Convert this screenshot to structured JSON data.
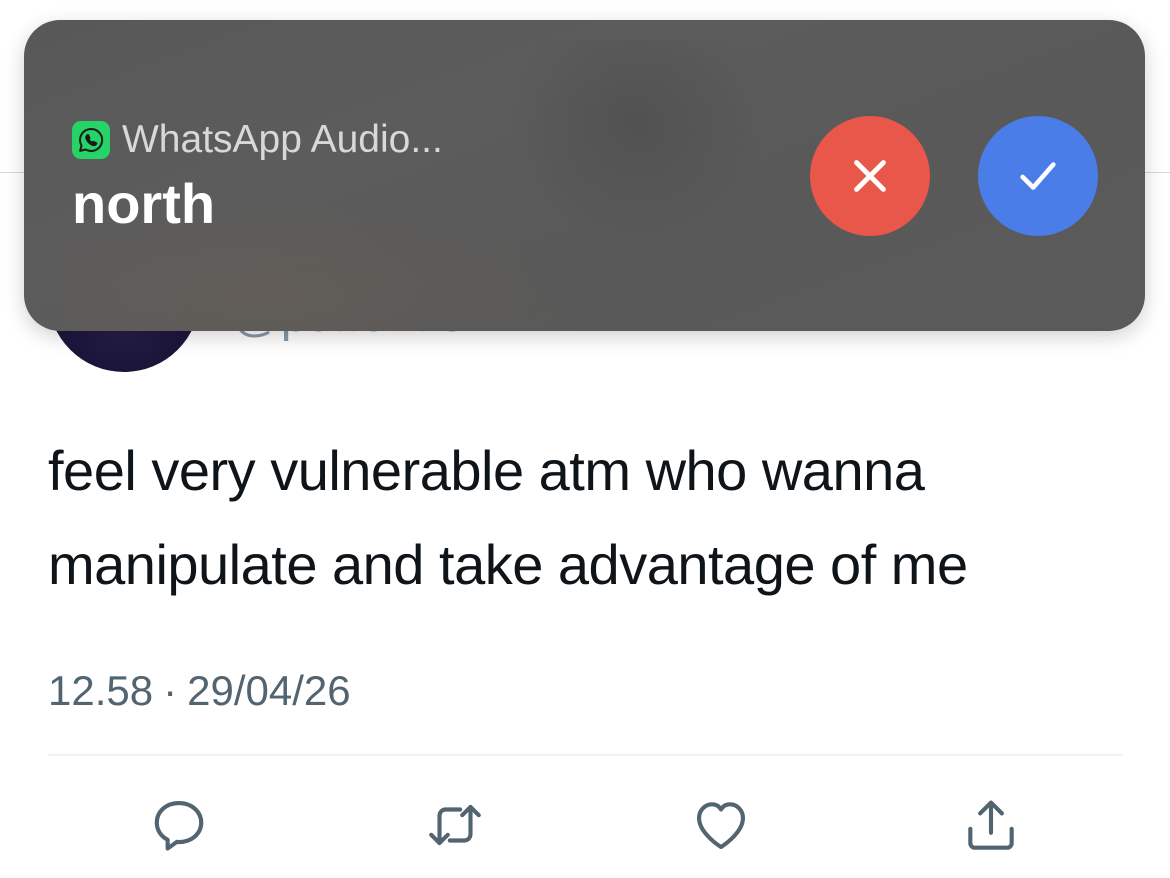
{
  "colors": {
    "decline": "#e8574a",
    "accept": "#4a7de8",
    "whatsapp": "#25d366",
    "text": "#0f1419",
    "muted": "#536471",
    "icon": "#536471"
  },
  "notification": {
    "app_icon": "whatsapp-icon",
    "app_name": "WhatsApp Audio...",
    "title": "north",
    "decline_icon": "close-icon",
    "accept_icon": "checkmark-icon"
  },
  "tweet": {
    "handle": "@puffer fish",
    "text": "feel very vulnerable atm who wanna manipulate and take advantage of me",
    "time": "12.58",
    "separator": "·",
    "date": "29/04/26"
  },
  "actions": [
    {
      "icon": "reply-icon"
    },
    {
      "icon": "retweet-icon"
    },
    {
      "icon": "like-icon"
    },
    {
      "icon": "share-icon"
    }
  ]
}
